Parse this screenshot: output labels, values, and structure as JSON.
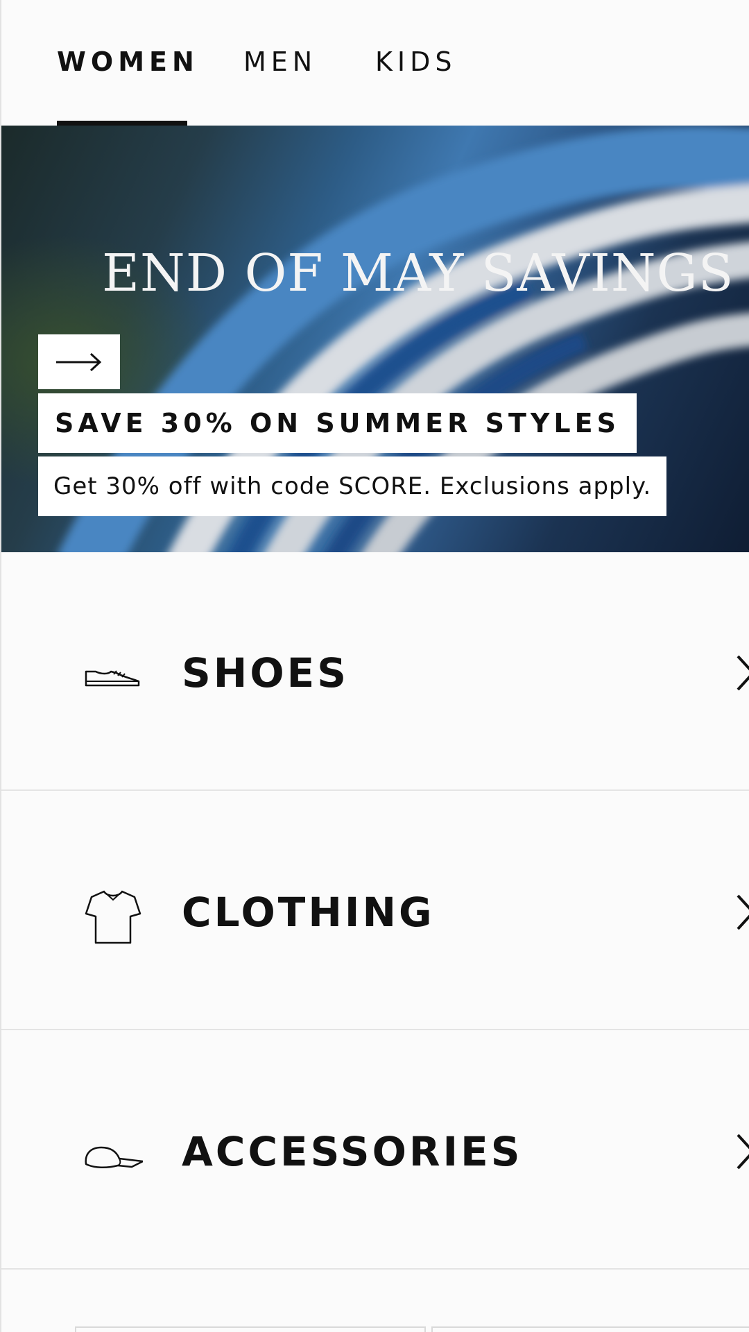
{
  "tabs": [
    {
      "label": "WOMEN",
      "active": true
    },
    {
      "label": "MEN",
      "active": false
    },
    {
      "label": "KIDS",
      "active": false
    }
  ],
  "hero": {
    "title": "END OF MAY SAVINGS",
    "arrow_icon": "arrow-right-icon",
    "headline": "SAVE 30% ON SUMMER STYLES",
    "subtext": "Get 30% off with code SCORE. Exclusions apply."
  },
  "categories": [
    {
      "label": "SHOES",
      "icon": "shoe-icon"
    },
    {
      "label": "CLOTHING",
      "icon": "tshirt-icon"
    },
    {
      "label": "ACCESSORIES",
      "icon": "cap-icon"
    }
  ],
  "colors": {
    "text": "#111111",
    "background": "#fbfbfb",
    "divider": "#e4e4e4",
    "hero_stripe": "#d9dde2"
  }
}
